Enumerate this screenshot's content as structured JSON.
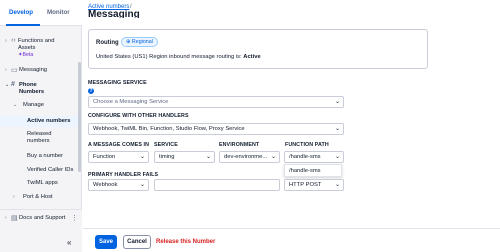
{
  "sidebar": {
    "tabs": [
      "Develop",
      "Monitor"
    ],
    "items": {
      "functions": {
        "label1": "Functions and",
        "label2": "Assets",
        "beta": "Beta"
      },
      "messaging": {
        "label": "Messaging"
      },
      "phone_numbers": {
        "label1": "Phone",
        "label2": "Numbers"
      },
      "manage": {
        "label": "Manage"
      },
      "active_numbers": {
        "label": "Active numbers"
      },
      "released_numbers": {
        "label1": "Released",
        "label2": "numbers"
      },
      "buy_number": {
        "label": "Buy a number"
      },
      "verified_caller_ids": {
        "label": "Verified Caller IDs"
      },
      "twiml_apps": {
        "label": "TwiML apps"
      },
      "port_host": {
        "label": "Port & Host"
      }
    },
    "bottom": {
      "docs_label": "Docs and Support"
    }
  },
  "main": {
    "breadcrumb": {
      "link": "Active numbers",
      "separator": "/"
    },
    "title": "Messaging",
    "routing": {
      "label": "Routing",
      "badge": "Regional",
      "text_prefix": "United States (US1) Region inbound message routing is: ",
      "status": "Active"
    },
    "messaging_service": {
      "label": "MESSAGING SERVICE",
      "placeholder": "Choose a Messaging Service"
    },
    "configure": {
      "label": "CONFIGURE WITH OTHER HANDLERS",
      "value": "Webhook, TwiML Bin, Function, Studio Flow, Proxy Service"
    },
    "message_comes_in": {
      "label": "A MESSAGE COMES IN",
      "type_value": "Function",
      "service_label": "SERVICE",
      "service_value": "timing",
      "environment_label": "ENVIRONMENT",
      "environment_value": "dev-environme...",
      "path_label": "FUNCTION PATH",
      "path_value": "/handle-sms",
      "dropdown_option": "/handle-sms"
    },
    "primary_fails": {
      "label": "PRIMARY HANDLER FAILS",
      "type_value": "Webhook",
      "url_value": "",
      "method_value": "HTTP POST"
    },
    "footer": {
      "save": "Save",
      "cancel": "Cancel",
      "release": "Release this Number"
    }
  }
}
